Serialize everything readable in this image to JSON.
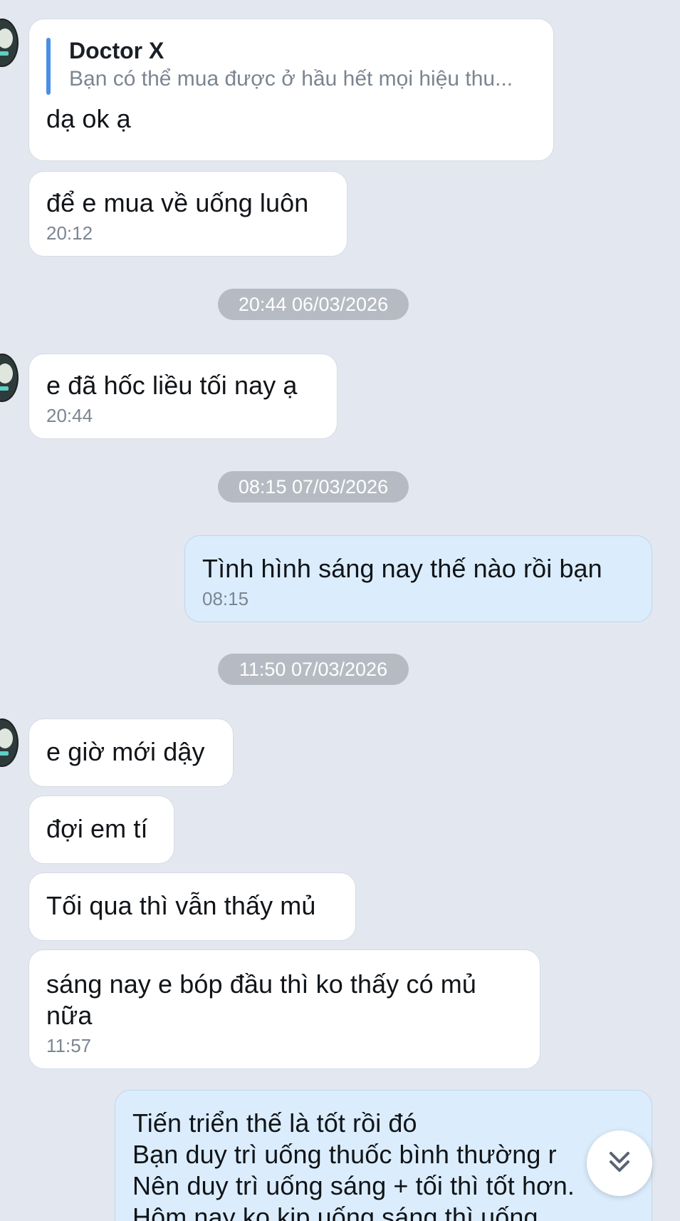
{
  "messages": [
    {
      "reply_author": "Doctor X",
      "reply_text": "Bạn có thể mua được ở hầu hết mọi hiệu thu...",
      "text": "dạ ok ạ"
    },
    {
      "text": "để e mua về uống luôn",
      "time": "20:12"
    },
    {
      "text": "e đã hốc liều tối nay ạ",
      "time": "20:44"
    },
    {
      "text": "Tình hình sáng nay thế nào rồi bạn",
      "time": "08:15"
    },
    {
      "text": "e giờ mới dậy"
    },
    {
      "text": "đợi em tí"
    },
    {
      "text": "Tối qua thì vẫn thấy mủ"
    },
    {
      "text_line1": "sáng nay e bóp đầu thì ko thấy có mủ",
      "text_line2": "nữa",
      "time": "11:57"
    },
    {
      "line1": "Tiến triển thế là tốt rồi đó",
      "line2": "Bạn duy trì uống thuốc bình thường r",
      "line3": "Nên duy trì uống sáng + tối thì tốt hơn.",
      "line4": "Hôm nay ko kịp uống sáng thì uống"
    }
  ],
  "date_separators": [
    "20:44 06/03/2026",
    "08:15 07/03/2026",
    "11:50 07/03/2026"
  ],
  "icons": {
    "scroll_down": "double-chevron-down-icon"
  },
  "colors": {
    "background": "#e3e7ef",
    "incoming": "#ffffff",
    "outgoing": "#dbedfd",
    "quote_bar": "#4a90e2",
    "date_chip": "#b6bbc3"
  }
}
